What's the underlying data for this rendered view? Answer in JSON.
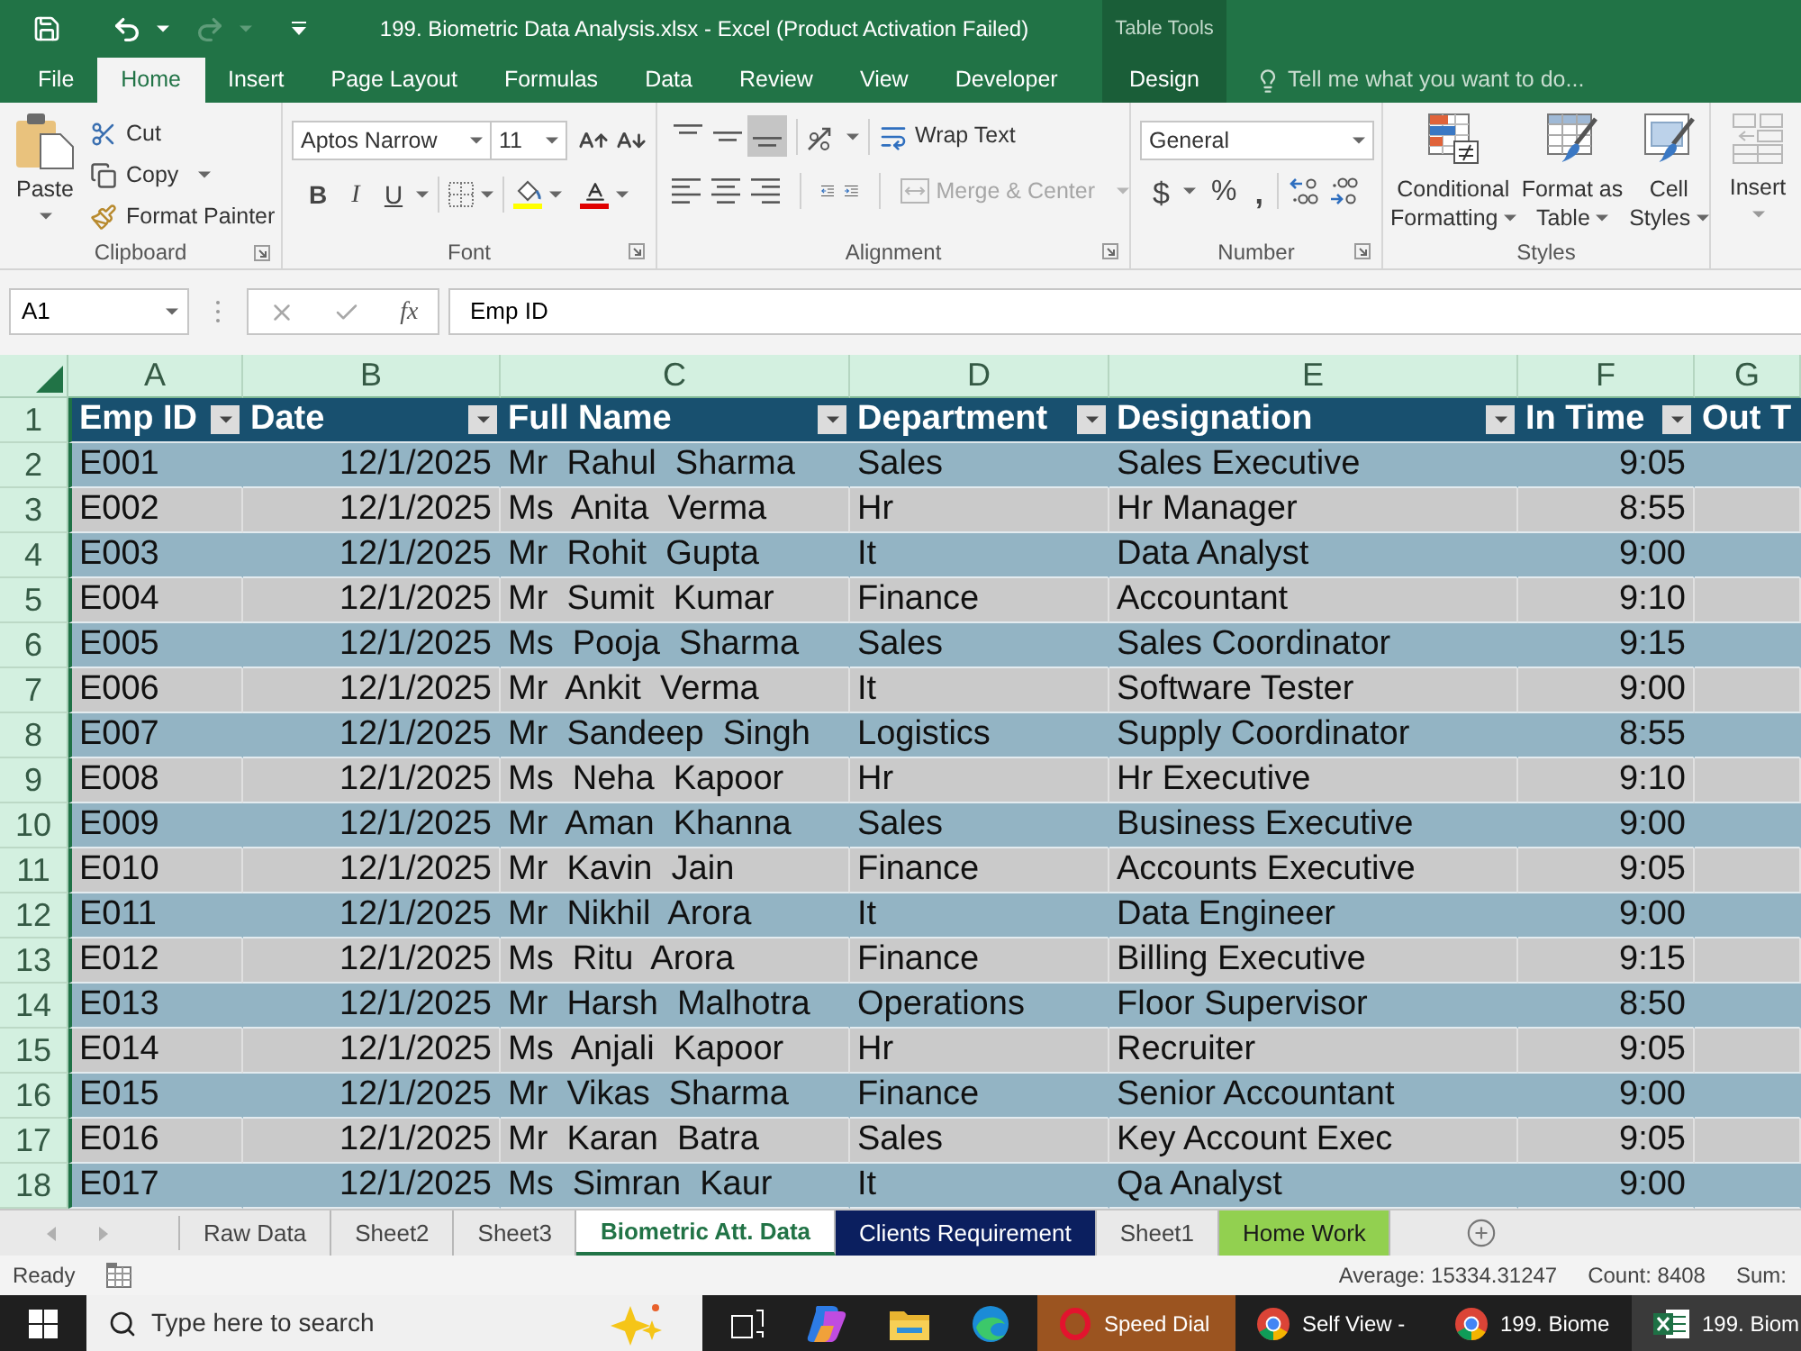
{
  "title_bar": {
    "title": "199. Biometric Data Analysis.xlsx - Excel (Product Activation Failed)",
    "context_label": "Table Tools"
  },
  "ribbon_tabs": [
    {
      "label": "File",
      "kind": "standard",
      "selected": false
    },
    {
      "label": "Home",
      "kind": "standard",
      "selected": true
    },
    {
      "label": "Insert",
      "kind": "standard",
      "selected": false
    },
    {
      "label": "Page Layout",
      "kind": "standard",
      "selected": false
    },
    {
      "label": "Formulas",
      "kind": "standard",
      "selected": false
    },
    {
      "label": "Data",
      "kind": "standard",
      "selected": false
    },
    {
      "label": "Review",
      "kind": "standard",
      "selected": false
    },
    {
      "label": "View",
      "kind": "standard",
      "selected": false
    },
    {
      "label": "Developer",
      "kind": "standard",
      "selected": false
    },
    {
      "label": "Design",
      "kind": "contextual",
      "selected": false
    }
  ],
  "tell_me": {
    "placeholder": "Tell me what you want to do..."
  },
  "clipboard": {
    "label": "Clipboard",
    "paste": "Paste",
    "cut": "Cut",
    "copy": "Copy",
    "format_painter": "Format Painter"
  },
  "font": {
    "label": "Font",
    "font_name": "Aptos Narrow",
    "font_size": "11",
    "format_buttons": [
      {
        "label": "B",
        "kind": "bold"
      },
      {
        "label": "I",
        "kind": "italic"
      },
      {
        "label": "U",
        "kind": "underline"
      }
    ]
  },
  "alignment": {
    "label": "Alignment",
    "vertical_align": [
      {
        "kind": "top",
        "selected": false
      },
      {
        "kind": "middle",
        "selected": false
      },
      {
        "kind": "bottom",
        "selected": true
      }
    ],
    "wrap_text": "Wrap Text",
    "merge_center": {
      "label": "Merge & Center",
      "disabled": true
    }
  },
  "number": {
    "label": "Number",
    "format": "General",
    "symbols": [
      {
        "label": "$",
        "kind": "currency"
      },
      {
        "label": "%",
        "kind": "percent"
      },
      {
        "label": ",",
        "kind": "comma"
      }
    ]
  },
  "styles": {
    "label": "Styles",
    "buttons": [
      {
        "kind": "conditional",
        "lines": [
          "Conditional",
          "Formatting"
        ]
      },
      {
        "kind": "table",
        "lines": [
          "Format as",
          "Table"
        ]
      },
      {
        "kind": "cell",
        "lines": [
          "Cell",
          "Styles"
        ]
      }
    ]
  },
  "cells": {
    "insert": "Insert"
  },
  "formula_bar": {
    "name_box": "A1",
    "function_label": "fx",
    "formula": "Emp ID"
  },
  "sheet": {
    "column_letters": [
      "A",
      "B",
      "C",
      "D",
      "E",
      "F",
      "G"
    ],
    "row_numbers": [
      "1",
      "2",
      "3",
      "4",
      "5",
      "6",
      "7",
      "8",
      "9",
      "10",
      "11",
      "12",
      "13",
      "14",
      "15",
      "16",
      "17",
      "18"
    ],
    "columns": [
      {
        "header": "Emp ID",
        "kind": "text",
        "filter": true
      },
      {
        "header": "Date",
        "kind": "date",
        "filter": true
      },
      {
        "header": "Full Name",
        "kind": "text",
        "filter": true
      },
      {
        "header": "Department",
        "kind": "text",
        "filter": true
      },
      {
        "header": "Designation",
        "kind": "text",
        "filter": true
      },
      {
        "header": "In Time",
        "kind": "time",
        "filter": true
      },
      {
        "header": "Out T",
        "kind": "time",
        "filter": false
      }
    ],
    "rows": [
      [
        "E001",
        "12/1/2025",
        "Mr  Rahul  Sharma",
        "Sales",
        "Sales Executive",
        "9:05"
      ],
      [
        "E002",
        "12/1/2025",
        "Ms  Anita  Verma",
        "Hr",
        "Hr Manager",
        "8:55"
      ],
      [
        "E003",
        "12/1/2025",
        "Mr  Rohit  Gupta",
        "It",
        "Data Analyst",
        "9:00"
      ],
      [
        "E004",
        "12/1/2025",
        "Mr  Sumit  Kumar",
        "Finance",
        "Accountant",
        "9:10"
      ],
      [
        "E005",
        "12/1/2025",
        "Ms  Pooja  Sharma",
        "Sales",
        "Sales Coordinator",
        "9:15"
      ],
      [
        "E006",
        "12/1/2025",
        "Mr  Ankit  Verma",
        "It",
        "Software Tester",
        "9:00"
      ],
      [
        "E007",
        "12/1/2025",
        "Mr  Sandeep  Singh",
        "Logistics",
        "Supply Coordinator",
        "8:55"
      ],
      [
        "E008",
        "12/1/2025",
        "Ms  Neha  Kapoor",
        "Hr",
        "Hr Executive",
        "9:10"
      ],
      [
        "E009",
        "12/1/2025",
        "Mr  Aman  Khanna",
        "Sales",
        "Business Executive",
        "9:00"
      ],
      [
        "E010",
        "12/1/2025",
        "Mr  Kavin  Jain",
        "Finance",
        "Accounts Executive",
        "9:05"
      ],
      [
        "E011",
        "12/1/2025",
        "Mr  Nikhil  Arora",
        "It",
        "Data Engineer",
        "9:00"
      ],
      [
        "E012",
        "12/1/2025",
        "Ms  Ritu  Arora",
        "Finance",
        "Billing Executive",
        "9:15"
      ],
      [
        "E013",
        "12/1/2025",
        "Mr  Harsh  Malhotra",
        "Operations",
        "Floor Supervisor",
        "8:50"
      ],
      [
        "E014",
        "12/1/2025",
        "Ms  Anjali  Kapoor",
        "Hr",
        "Recruiter",
        "9:05"
      ],
      [
        "E015",
        "12/1/2025",
        "Mr  Vikas  Sharma",
        "Finance",
        "Senior Accountant",
        "9:00"
      ],
      [
        "E016",
        "12/1/2025",
        "Mr  Karan  Batra",
        "Sales",
        "Key Account Exec",
        "9:05"
      ],
      [
        "E017",
        "12/1/2025",
        "Ms  Simran  Kaur",
        "It",
        "Qa Analyst",
        "9:00"
      ]
    ]
  },
  "sheet_tabs": [
    {
      "label": "Raw Data",
      "selected": false
    },
    {
      "label": "Sheet2",
      "selected": false
    },
    {
      "label": "Sheet3",
      "selected": false
    },
    {
      "label": "Biometric Att. Data",
      "selected": true
    },
    {
      "label": "Clients Requirement",
      "selected": false,
      "color": "#0b1f5f"
    },
    {
      "label": "Sheet1",
      "selected": false
    },
    {
      "label": "Home Work",
      "selected": false,
      "color": "#92d050"
    }
  ],
  "status_bar": {
    "mode": "Ready",
    "stats": [
      "Average: 15334.31247",
      "Count: 8408",
      "Sum:"
    ]
  },
  "taskbar": {
    "search": {
      "placeholder": "Type here to search"
    },
    "apps": [
      {
        "label": "Speed Dial",
        "kind": "opera",
        "selected": false,
        "flashing": true
      },
      {
        "label": "Self View -",
        "kind": "chrome",
        "selected": false,
        "flashing": false
      },
      {
        "label": "199. Biome",
        "kind": "chrome",
        "selected": false,
        "flashing": false
      },
      {
        "label": "199. Biom",
        "kind": "excel",
        "selected": true,
        "flashing": false
      }
    ]
  }
}
